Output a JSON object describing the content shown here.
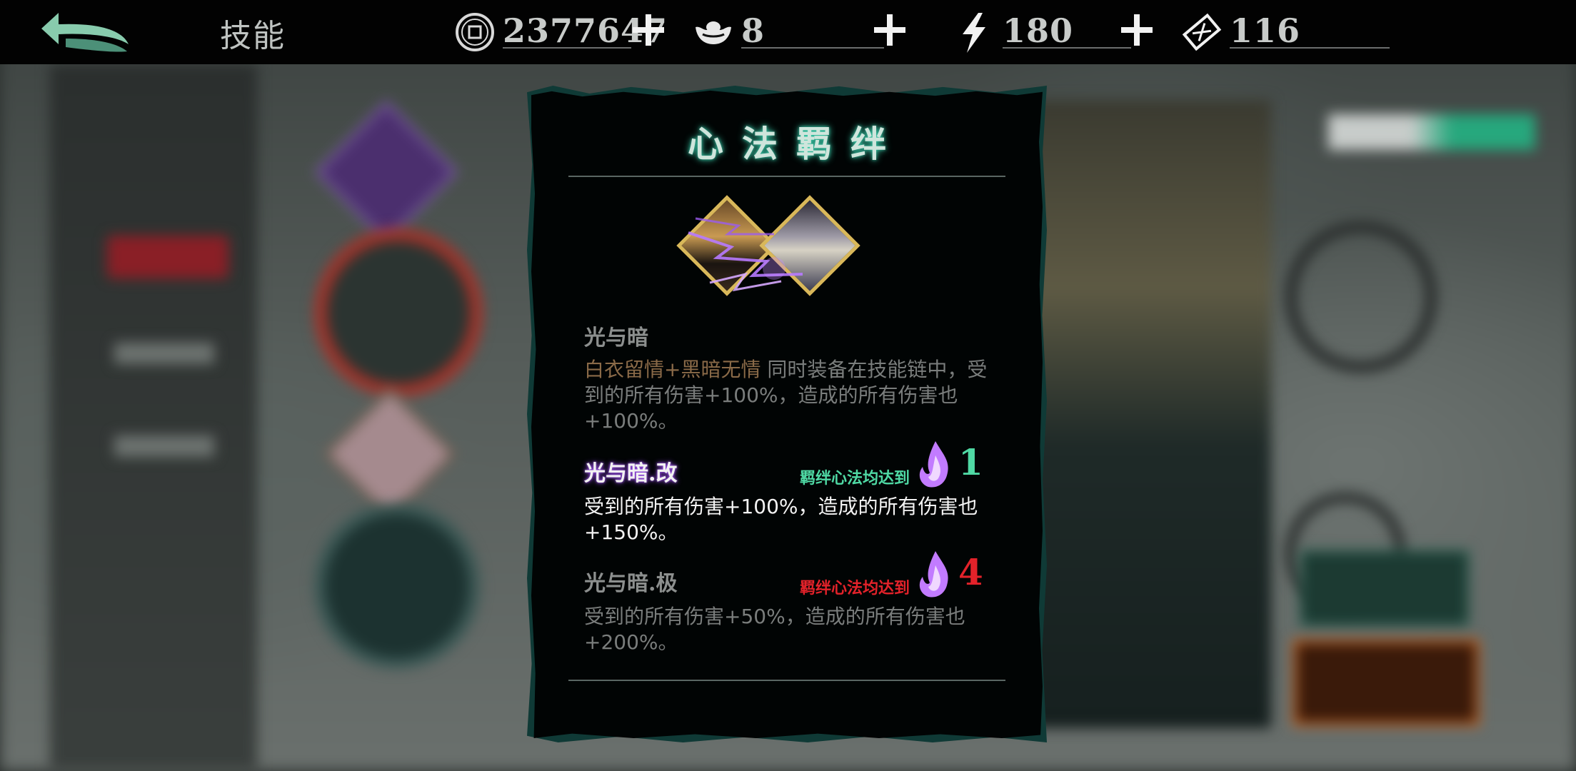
{
  "header": {
    "title": "技能",
    "resources": [
      {
        "icon": "coin-icon",
        "value": "2377647"
      },
      {
        "icon": "ingot-icon",
        "value": "8"
      },
      {
        "icon": "lightning-energy-icon",
        "value": "180"
      },
      {
        "icon": "ticket-icon",
        "value": "116"
      }
    ]
  },
  "dialog": {
    "title": "心法羁绊",
    "bond_name": "光与暗",
    "bond_skill_a": "白衣留情",
    "bond_skill_b": "+黑暗无情",
    "bond_desc_rest": " 同时装备在技能链中，受到的所有伤害+100%，造成的所有伤害也+100%。",
    "tiers": [
      {
        "name": "光与暗.改",
        "requirement": "羁绊心法均达到",
        "level": "1",
        "desc": "受到的所有伤害+100%，造成的所有伤害也+150%。",
        "active": true,
        "color": "#4fd9a4"
      },
      {
        "name": "光与暗.极",
        "requirement": "羁绊心法均达到",
        "level": "4",
        "desc": "受到的所有伤害+50%，造成的所有伤害也+200%。",
        "active": false,
        "color": "#e3222a"
      }
    ]
  },
  "colors": {
    "topbar_bg": "#020202",
    "dialog_bg": "#010404",
    "dialog_border": "#0f3a36",
    "title_glow": "#3fd8b4",
    "highlight_text": "#8a6a48"
  }
}
